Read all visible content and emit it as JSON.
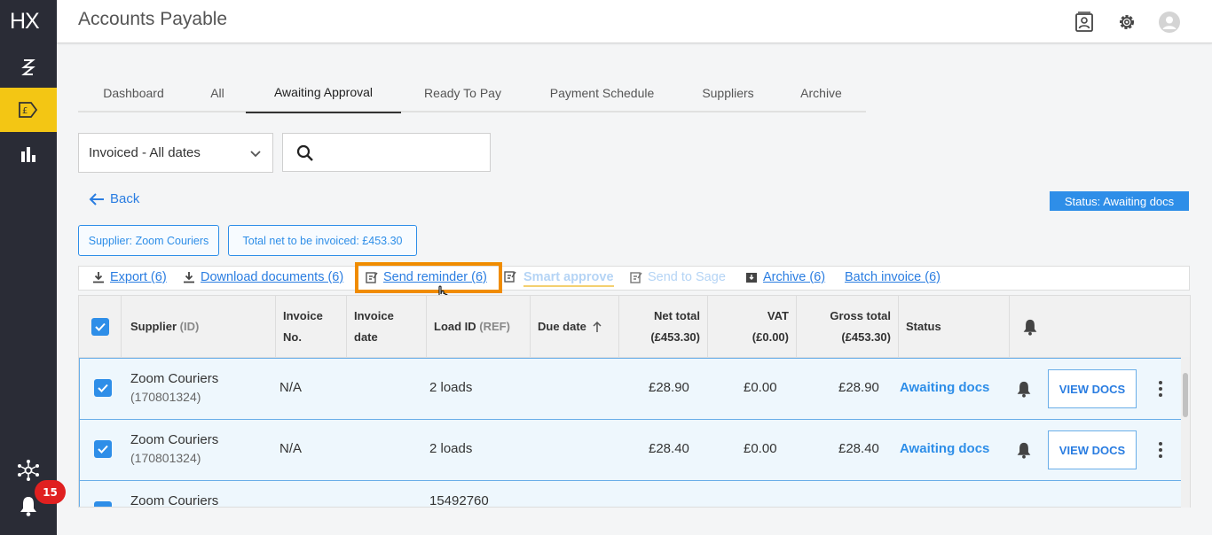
{
  "sidebar": {
    "logo": "HX",
    "notification_count": "15"
  },
  "header": {
    "title": "Accounts Payable"
  },
  "tabs": [
    {
      "label": "Dashboard"
    },
    {
      "label": "All"
    },
    {
      "label": "Awaiting Approval",
      "active": true
    },
    {
      "label": "Ready To Pay"
    },
    {
      "label": "Payment Schedule"
    },
    {
      "label": "Suppliers"
    },
    {
      "label": "Archive"
    }
  ],
  "filters": {
    "date_select": "Invoiced - All dates",
    "search_placeholder": ""
  },
  "back_label": "Back",
  "status_badge": "Status: Awaiting docs",
  "chips": {
    "supplier": "Supplier: Zoom Couriers",
    "total": "Total net to be invoiced: £453.30"
  },
  "toolbar": {
    "export": "Export (6)",
    "download": "Download documents (6)",
    "send_reminder": "Send reminder (6)",
    "smart_approve": "Smart approve",
    "send_to_sage": "Send to Sage",
    "archive": "Archive (6)",
    "batch_invoice": "Batch invoice (6)"
  },
  "table": {
    "headers": {
      "supplier": "Supplier",
      "supplier_sub": "(ID)",
      "invoice_no_1": "Invoice",
      "invoice_no_2": "No.",
      "invoice_date_1": "Invoice",
      "invoice_date_2": "date",
      "load_id": "Load ID",
      "load_id_sub": "(REF)",
      "due_date": "Due date",
      "net_total_1": "Net total",
      "net_total_2": "(£453.30)",
      "vat_1": "VAT",
      "vat_2": "(£0.00)",
      "gross_total_1": "Gross total",
      "gross_total_2": "(£453.30)",
      "status": "Status"
    },
    "rows": [
      {
        "supplier": "Zoom Couriers",
        "id": "(170801324)",
        "invoice_no": "N/A",
        "load": "2 loads",
        "net": "£28.90",
        "vat": "£0.00",
        "gross": "£28.90",
        "status": "Awaiting docs",
        "action": "VIEW DOCS"
      },
      {
        "supplier": "Zoom Couriers",
        "id": "(170801324)",
        "invoice_no": "N/A",
        "load": "2 loads",
        "net": "£28.40",
        "vat": "£0.00",
        "gross": "£28.40",
        "status": "Awaiting docs",
        "action": "VIEW DOCS"
      },
      {
        "supplier": "Zoom Couriers",
        "id": "",
        "invoice_no": "",
        "load": "15492760",
        "net": "",
        "vat": "",
        "gross": "",
        "status": "",
        "action": ""
      }
    ]
  },
  "colors": {
    "accent": "#2e8ee8",
    "sidebar": "#2a2c36",
    "active_nav": "#f3c614",
    "highlight": "#f08c00",
    "badge": "#e02020"
  }
}
